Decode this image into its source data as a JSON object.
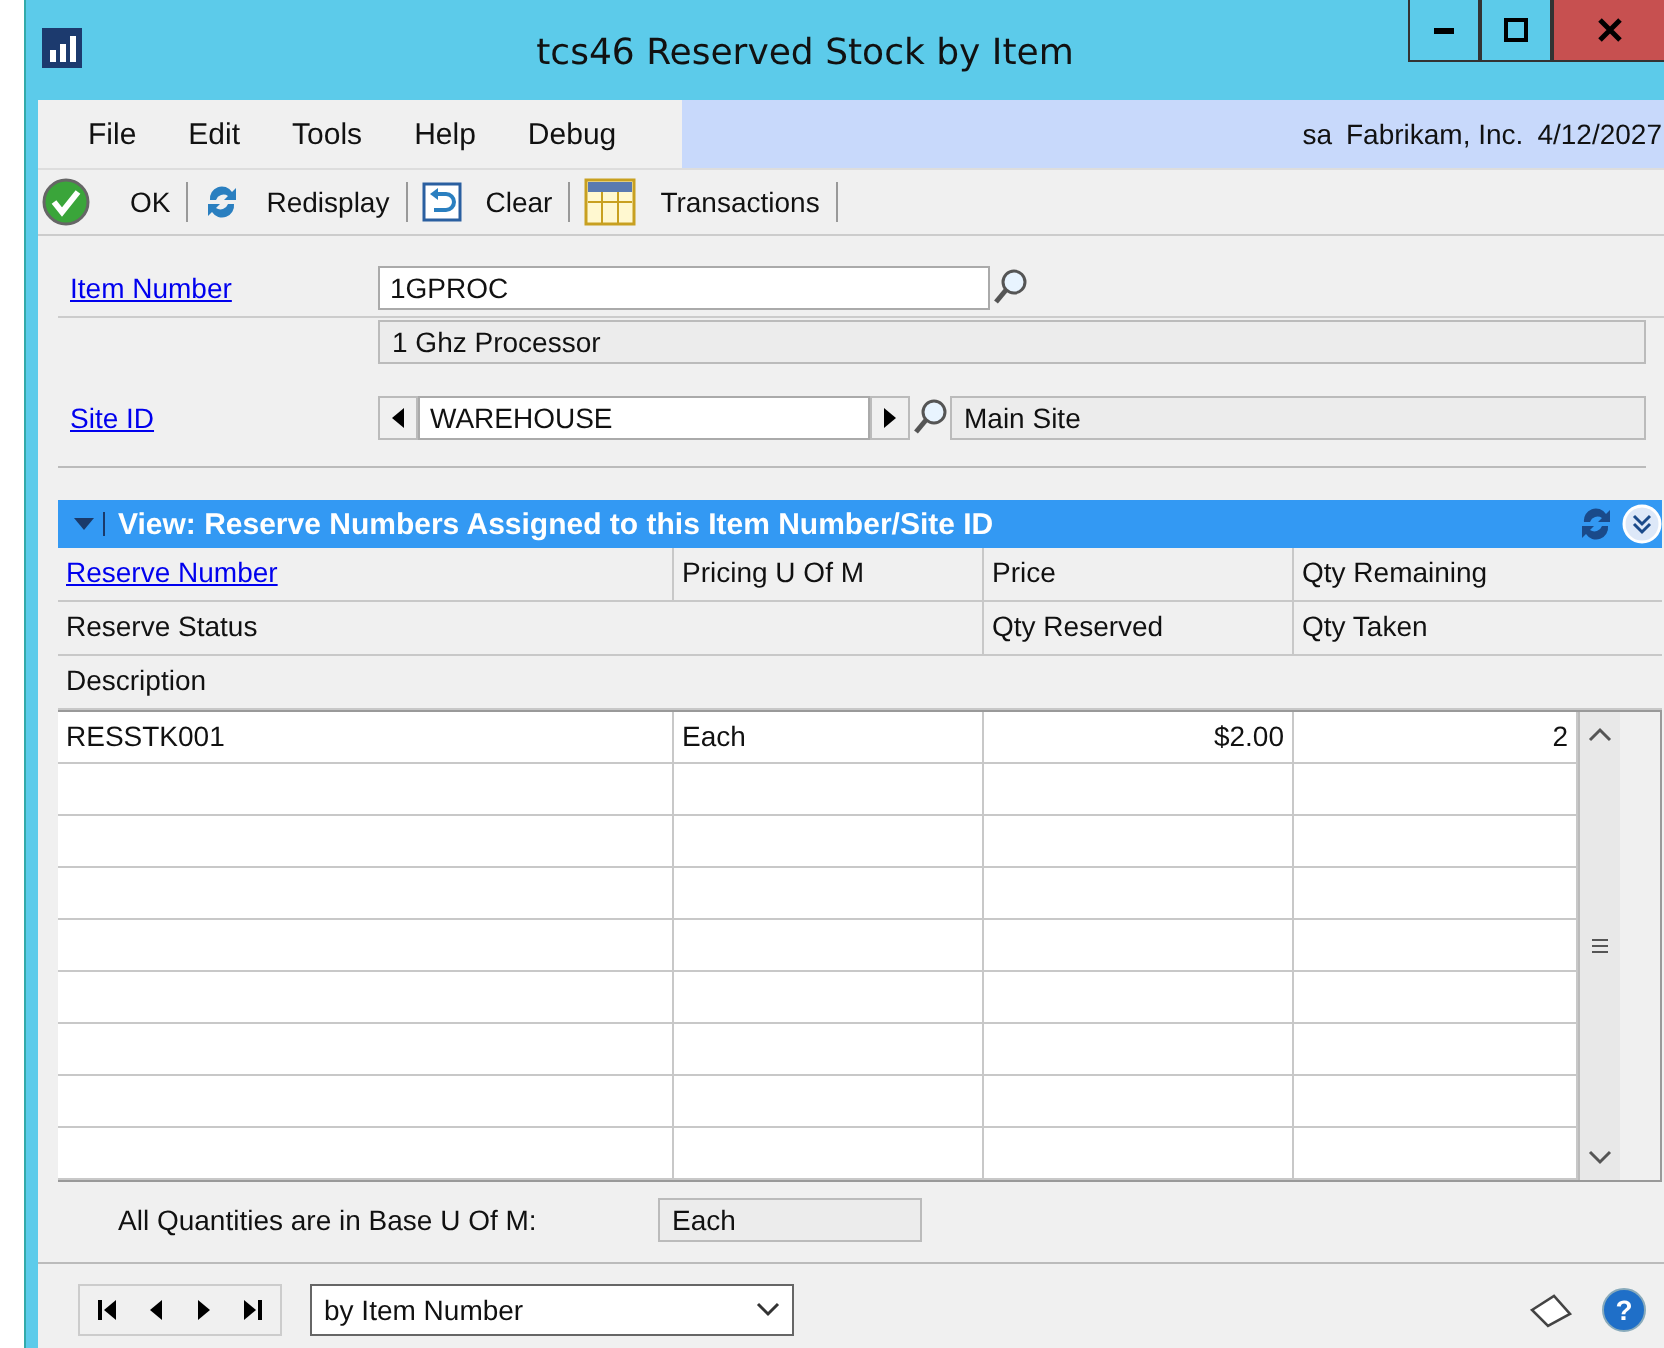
{
  "window": {
    "title": "tcs46 Reserved Stock by Item"
  },
  "menu": [
    "File",
    "Edit",
    "Tools",
    "Help",
    "Debug"
  ],
  "session": {
    "user": "sa",
    "company": "Fabrikam, Inc.",
    "date": "4/12/2027"
  },
  "toolbar": [
    {
      "kind": "ok",
      "label": "OK"
    },
    {
      "kind": "redisplay",
      "label": "Redisplay"
    },
    {
      "kind": "clear",
      "label": "Clear"
    },
    {
      "kind": "transactions",
      "label": "Transactions"
    }
  ],
  "item": {
    "label": "Item Number",
    "value": "1GPROC",
    "description": "1 Ghz Processor"
  },
  "site": {
    "label": "Site ID",
    "value": "WAREHOUSE",
    "description": "Main Site"
  },
  "grid": {
    "title": "View: Reserve Numbers Assigned to this Item Number/Site ID",
    "header_rows": [
      [
        {
          "text": "Reserve Number",
          "link": true
        },
        {
          "text": "Pricing U Of M",
          "link": false
        },
        {
          "text": "Price",
          "link": false
        },
        {
          "text": "Qty Remaining",
          "link": false
        }
      ],
      [
        {
          "text": "Reserve Status",
          "link": false
        },
        {
          "text": "Qty Reserved",
          "link": false
        },
        {
          "text": "Qty Taken",
          "link": false
        }
      ],
      [
        {
          "text": "Description",
          "link": false
        }
      ]
    ],
    "rows": [
      [
        "RESSTK001",
        "Each",
        "$2.00",
        "2"
      ]
    ]
  },
  "base_uom": {
    "label": "All Quantities are in Base U Of M:",
    "value": "Each"
  },
  "sort": {
    "value": "by Item Number"
  },
  "help": {
    "symbol": "?"
  }
}
